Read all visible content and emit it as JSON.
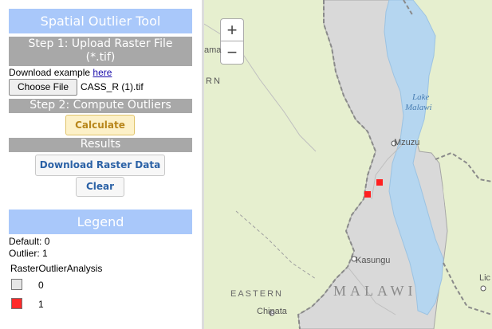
{
  "panel": {
    "title": "Spatial Outlier Tool",
    "step1": "Step 1: Upload Raster File (*.tif)",
    "download_example_prefix": "Download example ",
    "download_example_link": "here",
    "choose_file_button": "Choose File",
    "file_name": "CASS_R (1).tif",
    "step2": "Step 2: Compute Outliers",
    "calculate_button": "Calculate",
    "results_header": "Results",
    "download_raster_button": "Download Raster Data",
    "clear_button": "Clear",
    "legend_title": "Legend",
    "default_text": "Default: 0",
    "outlier_text": "Outlier: 1",
    "layer_name": "RasterOutlierAnalysis",
    "legend_items": [
      {
        "label": "0",
        "color": "#e6e6e6"
      },
      {
        "label": "1",
        "color": "#ff2a2a"
      }
    ]
  },
  "map": {
    "zoom_in": "+",
    "zoom_out": "−",
    "labels": {
      "ama": "ama",
      "rn": "RN",
      "lake": "Lake",
      "malawi_lake": "Malawi",
      "mzuzu": "Mzuzu",
      "kasungu": "Kasungu",
      "malawi": "MALAWI",
      "eastern": "EASTERN",
      "chipata": "Chipata",
      "lic": "Lic"
    },
    "colors": {
      "land": "#e6efcf",
      "country": "#d9d9d9",
      "lake": "#b5d6f0",
      "outlier": "#ff2020"
    }
  }
}
